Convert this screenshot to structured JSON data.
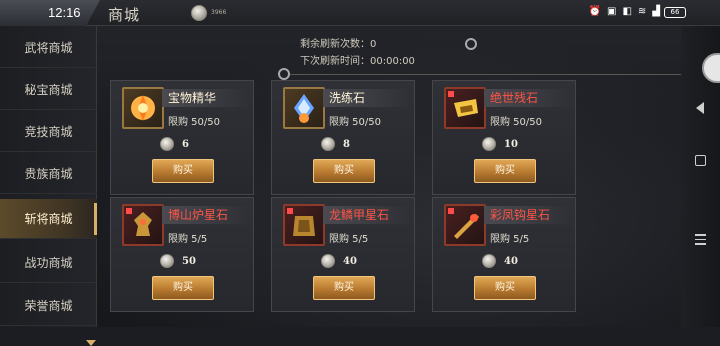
{
  "status_bar": {
    "time": "12:16",
    "battery": "66"
  },
  "header": {
    "title": "商城",
    "currency_amount": "3966"
  },
  "sidebar": {
    "items": [
      {
        "label": "武将商城",
        "active": false
      },
      {
        "label": "秘宝商城",
        "active": false
      },
      {
        "label": "竞技商城",
        "active": false
      },
      {
        "label": "贵族商城",
        "active": false
      },
      {
        "label": "斩将商城",
        "active": true
      },
      {
        "label": "战功商城",
        "active": false
      },
      {
        "label": "荣誉商城",
        "active": false
      }
    ]
  },
  "refresh": {
    "remaining_label": "剩余刷新次数：",
    "remaining_value": "0",
    "next_label": "下次刷新时间：",
    "next_value": "00:00:00"
  },
  "items": [
    {
      "name": "宝物精华",
      "name_color": "gold",
      "limit": "限购  50/50",
      "price": "6",
      "buy_label": "购买"
    },
    {
      "name": "洗练石",
      "name_color": "gold",
      "limit": "限购  50/50",
      "price": "8",
      "buy_label": "购买"
    },
    {
      "name": "绝世残石",
      "name_color": "red",
      "limit": "限购  50/50",
      "price": "10",
      "buy_label": "购买"
    },
    {
      "name": "博山炉星石",
      "name_color": "red",
      "limit": "限购  5/5",
      "price": "50",
      "buy_label": "购买"
    },
    {
      "name": "龙鳞甲星石",
      "name_color": "red",
      "limit": "限购  5/5",
      "price": "40",
      "buy_label": "购买"
    },
    {
      "name": "彩凤钩星石",
      "name_color": "red",
      "limit": "限购  5/5",
      "price": "40",
      "buy_label": "购买"
    }
  ],
  "colors": {
    "accent_gold": "#d8b06a",
    "name_red": "#ff5446",
    "button_gold": "#c98c3b"
  }
}
